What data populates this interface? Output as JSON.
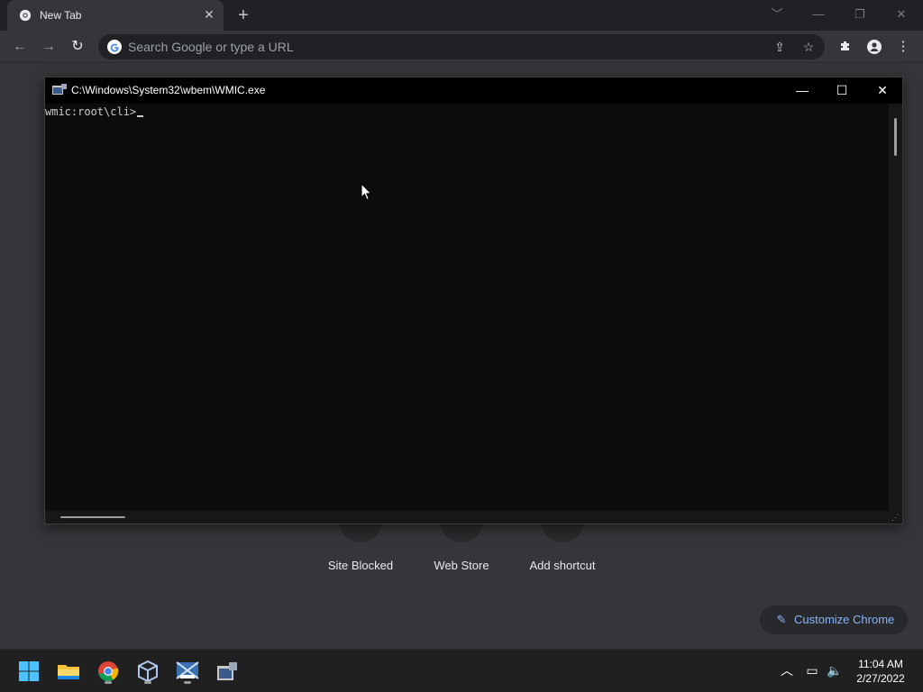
{
  "browser": {
    "tab": {
      "title": "New Tab",
      "close_glyph": "✕",
      "favicon": "chrome-icon"
    },
    "new_tab_glyph": "+",
    "window_controls": {
      "tabsearch": "﹀",
      "minimize": "—",
      "restore": "❐",
      "close": "✕"
    },
    "nav": {
      "back": "←",
      "forward": "→",
      "reload": "↻"
    },
    "omnibox": {
      "placeholder": "Search Google or type a URL",
      "value": ""
    },
    "omnibox_actions": {
      "share": "⇪",
      "bookmark": "☆"
    },
    "toolbar_icons": {
      "extensions": "extensions-icon",
      "profile": "profile-icon",
      "menu": "⋮"
    }
  },
  "new_tab_page": {
    "shortcuts": [
      {
        "label": "Site Blocked"
      },
      {
        "label": "Web Store"
      },
      {
        "label": "Add shortcut"
      }
    ],
    "customize": {
      "label": "Customize Chrome",
      "icon": "✎"
    }
  },
  "console": {
    "title": "C:\\Windows\\System32\\wbem\\WMIC.exe",
    "prompt": "wmic:root\\cli>",
    "controls": {
      "minimize": "—",
      "maximize": "☐",
      "close": "✕"
    },
    "grip": "⋰"
  },
  "taskbar": {
    "apps": [
      "start-icon",
      "file-explorer-icon",
      "chrome-icon",
      "virtualbox-icon",
      "vista-app-icon",
      "wmic-icon"
    ],
    "tray": {
      "chevron": "︿",
      "network": "▭",
      "volume": "🔈"
    },
    "time": "11:04 AM",
    "date": "2/27/2022"
  },
  "colors": {
    "accent": "#8ab4f8",
    "background": "#35363a",
    "console_bg": "#0c0c0c",
    "taskbar": "#202020"
  }
}
